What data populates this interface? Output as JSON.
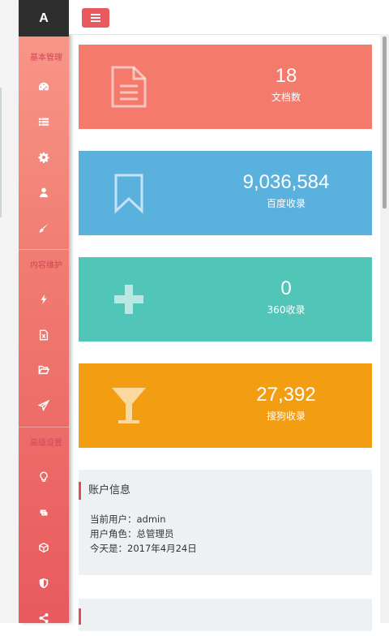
{
  "sidebar": {
    "brand": "A",
    "sections": [
      {
        "title": "基本管理",
        "items": [
          "dashboard-icon",
          "list-icon",
          "gear-icon",
          "user-icon",
          "brush-icon"
        ]
      },
      {
        "title": "内容维护",
        "items": [
          "bolt-icon",
          "excel-file-icon",
          "folder-open-icon",
          "paper-plane-icon"
        ]
      },
      {
        "title": "高级设置",
        "items": [
          "lightbulb-icon",
          "retweet-icon",
          "cube-icon",
          "shield-icon",
          "share-icon"
        ]
      }
    ]
  },
  "stats": [
    {
      "value": "18",
      "label": "文档数",
      "color": "#f47a6b",
      "icon": "document-icon"
    },
    {
      "value": "9,036,584",
      "label": "百度收录",
      "color": "#5bb1dd",
      "icon": "bookmark-icon"
    },
    {
      "value": "0",
      "label": "360收录",
      "color": "#51c5b7",
      "icon": "plus-icon"
    },
    {
      "value": "27,392",
      "label": "搜狗收录",
      "color": "#f39d12",
      "icon": "trophy-icon"
    }
  ],
  "account": {
    "title": "账户信息",
    "current_user": "当前用户：admin",
    "role": "用户角色：总管理员",
    "today": "今天是：2017年4月24日"
  },
  "colors": {
    "accent": "#e85a5e",
    "brand_bg": "#2d2d2d",
    "panel_bg": "#eef1f3"
  }
}
